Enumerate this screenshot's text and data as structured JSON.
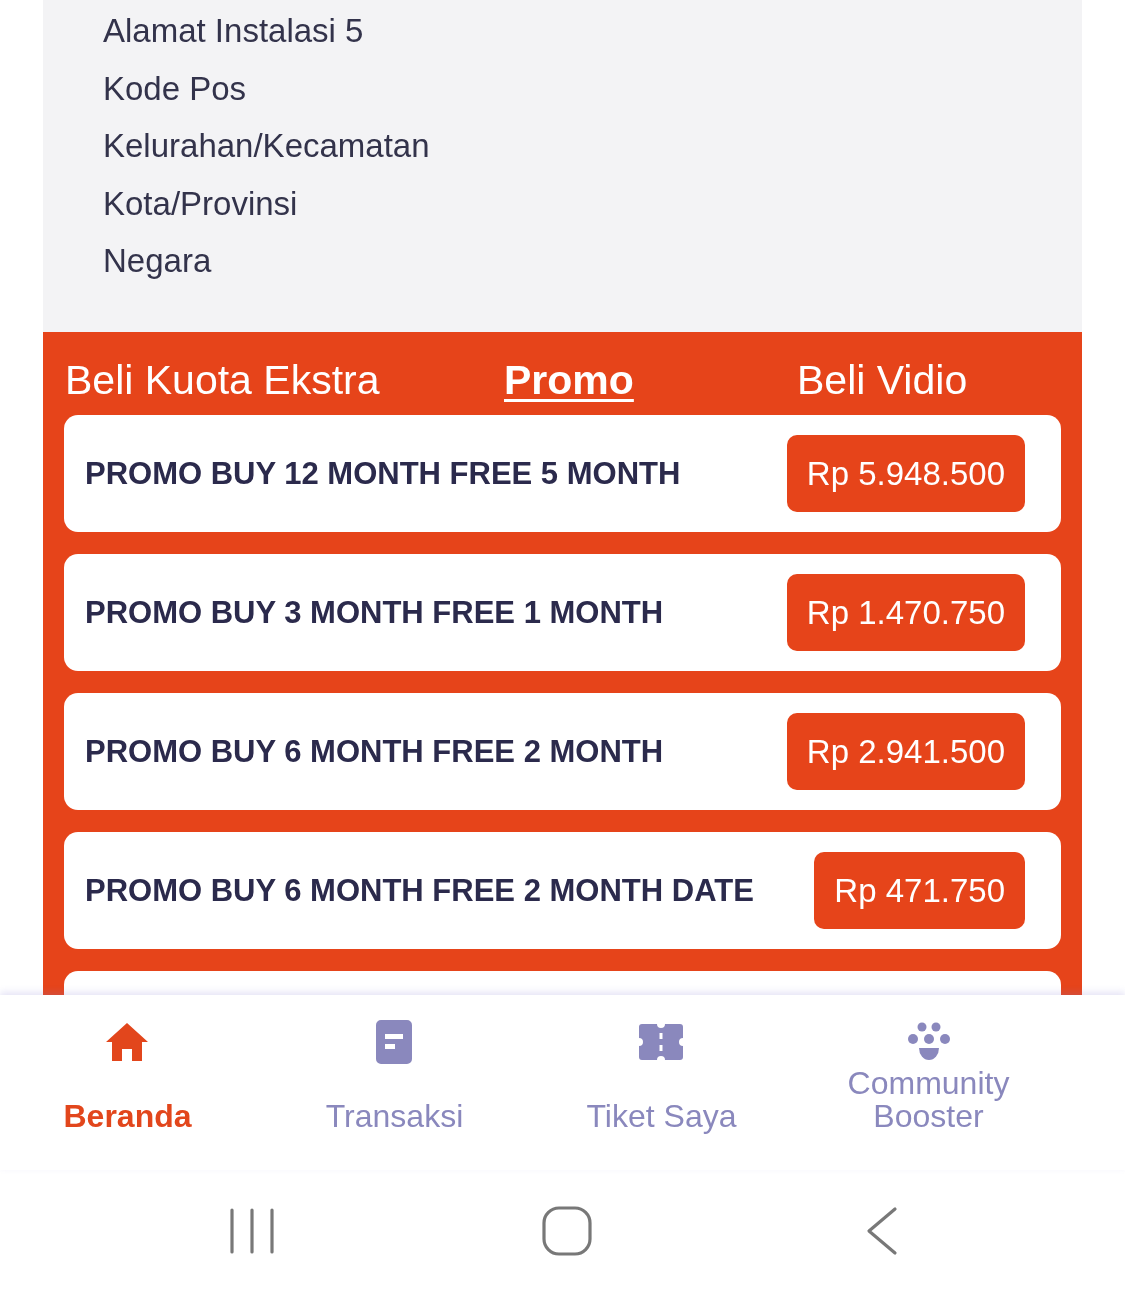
{
  "address_fields": [
    "Alamat Instalasi 5",
    "Kode Pos",
    "Kelurahan/Kecamatan",
    "Kota/Provinsi",
    "Negara"
  ],
  "purchase_tabs": [
    {
      "label": "Beli Kuota Ekstra",
      "selected": false
    },
    {
      "label": "Promo",
      "selected": true
    },
    {
      "label": "Beli Vidio",
      "selected": false
    }
  ],
  "promo_list": {
    "items": [
      {
        "title": "PROMO BUY 12 MONTH FREE 5 MONTH",
        "price": "Rp 5.948.500"
      },
      {
        "title": "PROMO BUY 3 MONTH FREE 1 MONTH",
        "price": "Rp 1.470.750"
      },
      {
        "title": "PROMO BUY 6 MONTH FREE 2 MONTH",
        "price": "Rp 2.941.500"
      },
      {
        "title": "PROMO BUY 6 MONTH FREE 2 MONTH DATE",
        "price": "Rp 471.750"
      }
    ],
    "more_below": true
  },
  "bottom_nav": [
    {
      "label": "Beranda",
      "selected": true
    },
    {
      "label": "Transaksi",
      "selected": false
    },
    {
      "label": "Tiket Saya",
      "selected": false
    },
    {
      "label": "Community Booster",
      "selected": false
    }
  ]
}
